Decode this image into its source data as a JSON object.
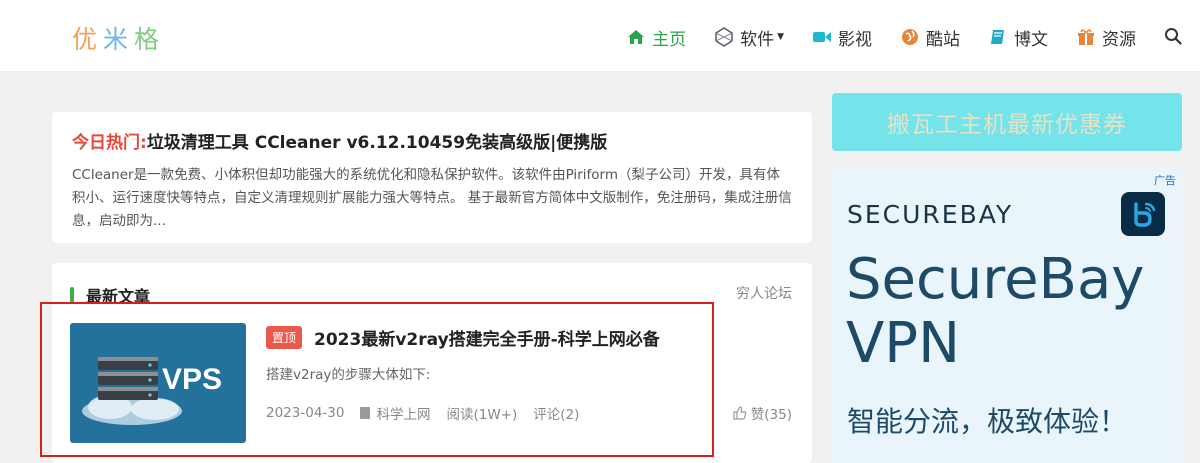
{
  "site": {
    "logo_chars": [
      "优",
      "米",
      "格"
    ]
  },
  "nav": {
    "items": [
      {
        "label": "主页",
        "icon": "home-icon",
        "active": true
      },
      {
        "label": "软件",
        "icon": "software-icon",
        "has_dropdown": true
      },
      {
        "label": "影视",
        "icon": "video-icon"
      },
      {
        "label": "酷站",
        "icon": "globe-icon"
      },
      {
        "label": "博文",
        "icon": "book-icon"
      },
      {
        "label": "资源",
        "icon": "gift-icon"
      }
    ],
    "search_icon": "search-icon"
  },
  "hot": {
    "label": "今日热门:",
    "title": "垃圾清理工具 CCleaner v6.12.10459免装高级版|便携版",
    "description": "CCleaner是一款免费、小体积但却功能强大的系统优化和隐私保护软件。该软件由Piriform（梨子公司）开发，具有体积小、运行速度快等特点，自定义清理规则扩展能力强大等特点。 基于最新官方简体中文版制作，免注册码，集成注册信息，启动即为..."
  },
  "latest": {
    "section_title": "最新文章",
    "more_label": "穷人论坛",
    "post": {
      "badge": "置顶",
      "title": "2023最新v2ray搭建完全手册-科学上网必备",
      "excerpt": "搭建v2ray的步骤大体如下:",
      "date": "2023-04-30",
      "category": "科学上网",
      "reads": "阅读(1W+)",
      "comments": "评论(2)",
      "likes": "赞(35)",
      "thumb_text": "VPS"
    }
  },
  "sidebar": {
    "promo_label": "搬瓦工主机最新优惠券",
    "ad": {
      "tag": "广告",
      "brand": "SECUREBAY",
      "headline_line1": "SecureBay",
      "headline_line2": "VPN",
      "subline": "智能分流，极致体验！"
    }
  },
  "colors": {
    "accent_green": "#2aa44a",
    "hot_red": "#e8473a",
    "badge_red": "#ea5a4c",
    "promo_bg": "#74e3ea",
    "ad_bg": "#e9f5fb"
  }
}
